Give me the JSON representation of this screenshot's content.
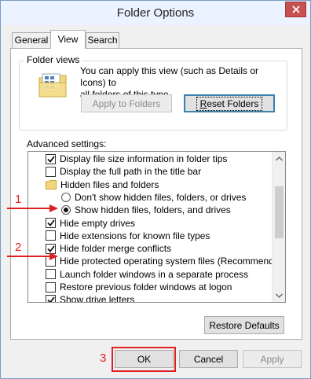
{
  "window": {
    "title": "Folder Options",
    "close_label": "×"
  },
  "tabs": [
    {
      "label": "General",
      "active": false
    },
    {
      "label": "View",
      "active": true
    },
    {
      "label": "Search",
      "active": false
    }
  ],
  "folder_views": {
    "group_title": "Folder views",
    "description": "You can apply this view (such as Details or Icons) to all of this type.",
    "description_line1": "You can apply this view (such as Details or Icons) to",
    "description_line2": "all folders of this type.",
    "apply_button": "Apply to Folders",
    "reset_button": "Reset Folders",
    "reset_mnemonic": "R",
    "reset_rest": "eset Folders"
  },
  "advanced": {
    "label": "Advanced settings:",
    "items": [
      {
        "kind": "checkbox",
        "checked": true,
        "label": "Display file size information in folder tips"
      },
      {
        "kind": "checkbox",
        "checked": false,
        "label": "Display the full path in the title bar"
      },
      {
        "kind": "folder",
        "label": "Hidden files and folders"
      },
      {
        "kind": "radio",
        "checked": false,
        "label": "Don't show hidden files, folders, or drives"
      },
      {
        "kind": "radio",
        "checked": true,
        "label": "Show hidden files, folders, and drives"
      },
      {
        "kind": "checkbox",
        "checked": true,
        "label": "Hide empty drives"
      },
      {
        "kind": "checkbox",
        "checked": false,
        "label": "Hide extensions for known file types"
      },
      {
        "kind": "checkbox",
        "checked": true,
        "label": "Hide folder merge conflicts"
      },
      {
        "kind": "checkbox",
        "checked": false,
        "label": "Hide protected operating system files (Recommended)"
      },
      {
        "kind": "checkbox",
        "checked": false,
        "label": "Launch folder windows in a separate process"
      },
      {
        "kind": "checkbox",
        "checked": false,
        "label": "Restore previous folder windows at logon"
      },
      {
        "kind": "checkbox",
        "checked": true,
        "label": "Show drive letters"
      }
    ]
  },
  "restore_defaults_button": "Restore Defaults",
  "footer": {
    "ok": "OK",
    "cancel": "Cancel",
    "apply": "Apply"
  },
  "annotations": {
    "step1": "1",
    "step2": "2",
    "step3": "3",
    "color": "#e02020"
  },
  "colors": {
    "titlebar": "#eaf3ff",
    "close": "#c75050",
    "dialog_bg": "#f0f0f0",
    "focus_border": "#3c7fb1"
  }
}
